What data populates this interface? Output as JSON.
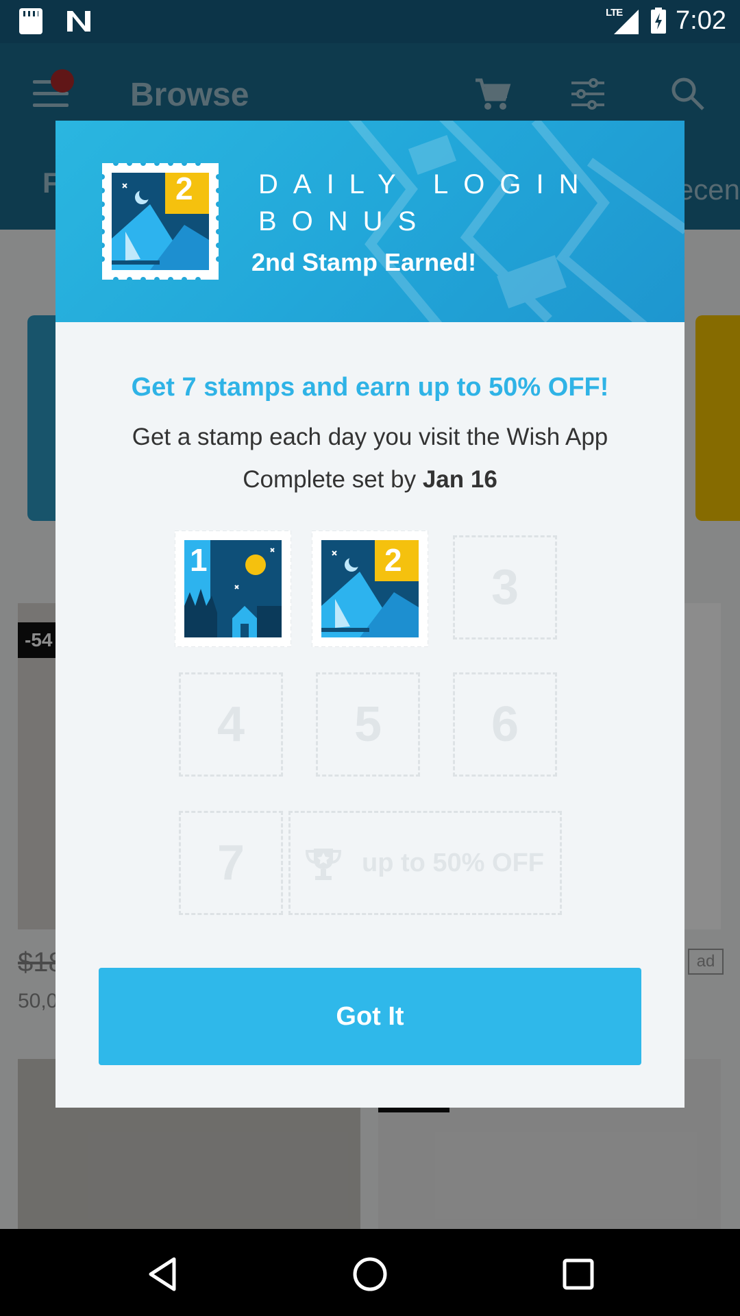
{
  "status_bar": {
    "time": "7:02",
    "network": "LTE"
  },
  "header": {
    "title": "Browse",
    "tab_left_fragment": "F",
    "tab_right_fragment": "ecen"
  },
  "background_products": {
    "discount_badge": "-54",
    "price_fragment": "$18",
    "count_fragment": "50,0",
    "ad_label": "ad"
  },
  "dialog": {
    "banner": {
      "title_line1": "DAILY LOGIN",
      "title_line2": "BONUS",
      "subtitle": "2nd Stamp Earned!",
      "stamp_number": "2"
    },
    "offer_title": "Get 7 stamps and earn up to 50% OFF!",
    "offer_line1": "Get a stamp each day you visit the Wish App",
    "offer_line2_prefix": "Complete set by ",
    "offer_line2_date": "Jan 16",
    "stamps": {
      "earned": [
        "1",
        "2"
      ],
      "pending": [
        "3",
        "4",
        "5",
        "6",
        "7"
      ]
    },
    "reward_label": "up to 50% OFF",
    "button_label": "Got It"
  },
  "colors": {
    "accent": "#2fb8ea",
    "stamp_dark": "#0e4f78",
    "stamp_light": "#2db3ee",
    "stamp_yellow": "#f5c10e"
  },
  "icons": [
    "sd-card-icon",
    "n-icon",
    "lte-signal-icon",
    "battery-icon",
    "menu-icon",
    "cart-icon",
    "filter-icon",
    "search-icon",
    "trophy-icon",
    "back-icon",
    "home-icon",
    "recents-icon"
  ]
}
